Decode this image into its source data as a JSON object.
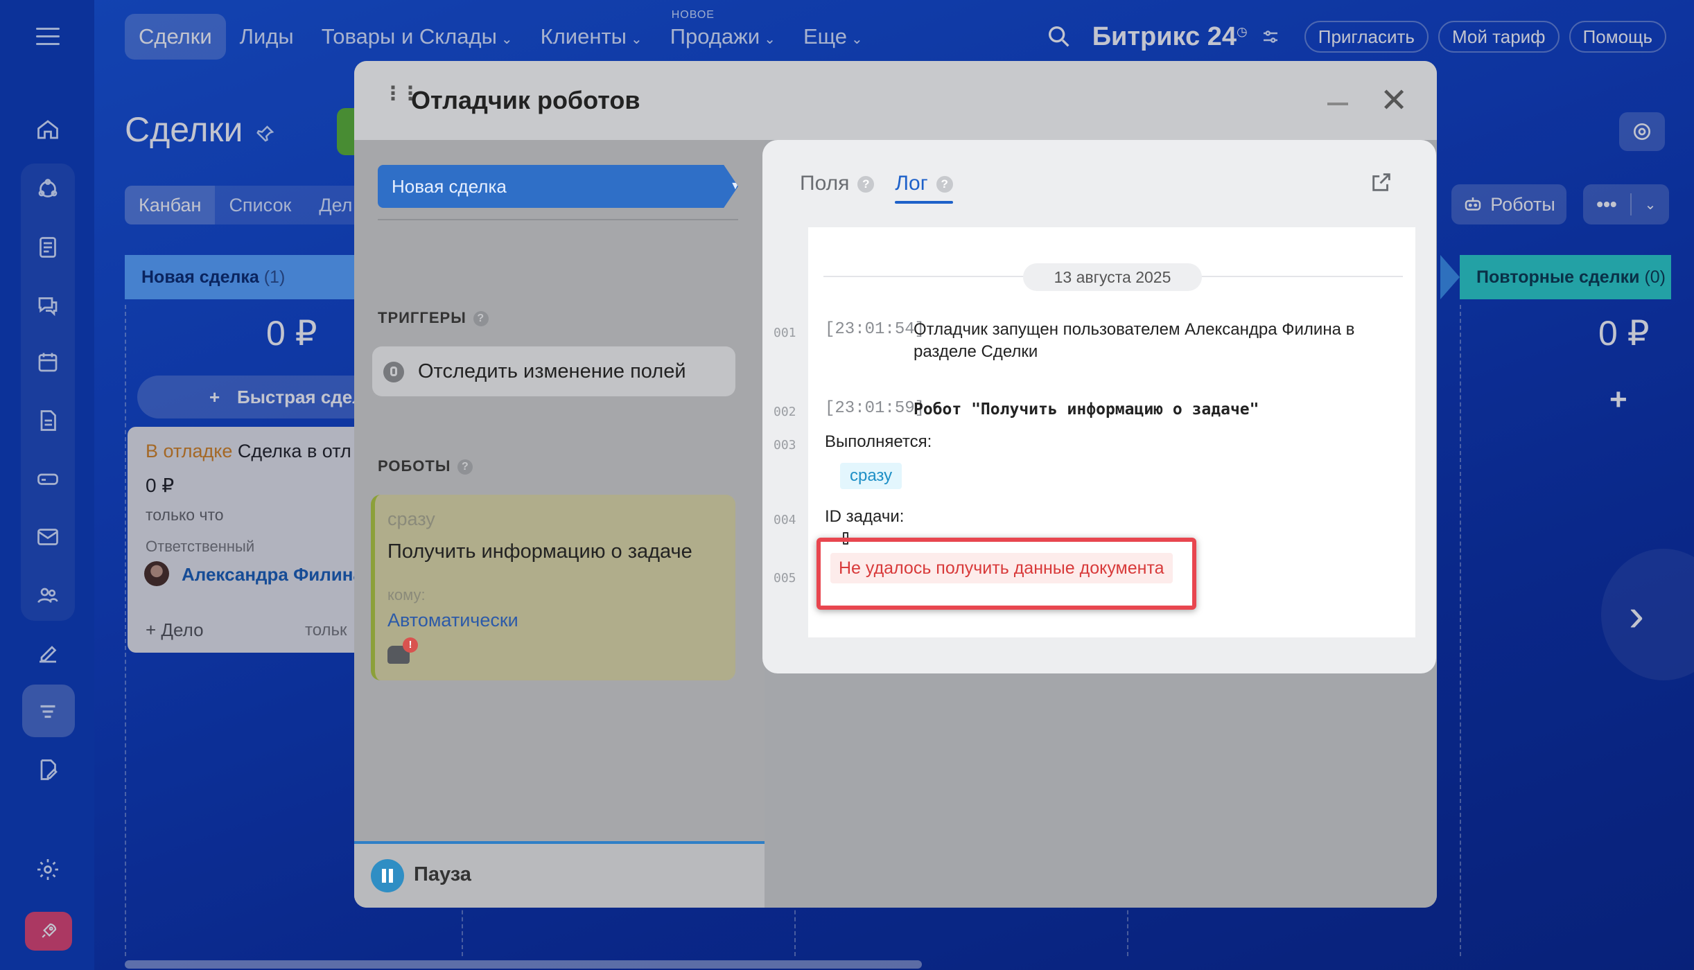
{
  "top_nav": {
    "items": [
      {
        "label": "Сделки",
        "active": true,
        "has_menu": false
      },
      {
        "label": "Лиды",
        "has_menu": false
      },
      {
        "label": "Товары и Склады",
        "has_menu": true
      },
      {
        "label": "Клиенты",
        "has_menu": true
      },
      {
        "label": "Продажи",
        "has_menu": true,
        "badge": "НОВОЕ"
      },
      {
        "label": "Еще",
        "has_menu": true
      }
    ],
    "brand": "Битрикс 24",
    "brand_mark": "◷",
    "buttons": {
      "invite": "Пригласить",
      "tariff": "Мой тариф",
      "help": "Помощь"
    }
  },
  "page": {
    "title": "Сделки",
    "view_tabs": [
      "Канбан",
      "Список",
      "Дел"
    ],
    "robots_button": "Роботы",
    "more_button": "•••"
  },
  "kanban": {
    "new_column": {
      "title": "Новая сделка",
      "count": "(1)",
      "sum": "0 ₽",
      "quick_add": "Быстрая сдел"
    },
    "repeat_column": {
      "title": "Повторные сделки",
      "count": "(0)",
      "sum": "0 ₽",
      "add": "+"
    },
    "card": {
      "debug_label": "В отладке",
      "name": "Сделка в отл",
      "sum": "0 ₽",
      "time": "только что",
      "responsible_label": "Ответственный",
      "responsible_name": "Александра Филина",
      "add_task": "+ Дело",
      "task_time": "тольк"
    },
    "next_arrow": "›"
  },
  "modal": {
    "title": "Отладчик роботов",
    "stage": "Новая сделка",
    "triggers_title": "ТРИГГЕРЫ",
    "trigger": "Отследить изменение полей",
    "robots_title": "РОБОТЫ",
    "robot": {
      "when": "сразу",
      "name": "Получить информацию о задаче",
      "to_label": "кому:",
      "to_value": "Автоматически",
      "warn": "!"
    },
    "pause_label": "Пауза",
    "question": "?"
  },
  "log_panel": {
    "tabs": [
      {
        "label": "Поля",
        "active": false
      },
      {
        "label": "Лог",
        "active": true
      }
    ],
    "date": "13 августа 2025",
    "rows": [
      {
        "num": "001",
        "time": "[23:01:54]",
        "text1": "Отладчик запущен пользователем Александра Филина в",
        "text2": "разделе Сделки"
      },
      {
        "num": "002",
        "time": "[23:01:59]",
        "text": "Робот \"Получить информацию о задаче\""
      },
      {
        "num": "003",
        "text": "Выполняется:",
        "tag": "сразу"
      },
      {
        "num": "004",
        "text": "ID задачи:"
      },
      {
        "num": "005",
        "text": "Не удалось получить данные документа"
      }
    ]
  },
  "colors": {
    "accent": "#1e61c9",
    "error": "#d83a3a",
    "debug_label": "#d7841f",
    "new_column": "#5aa6ff",
    "repeat_column": "#2bd0c9"
  }
}
